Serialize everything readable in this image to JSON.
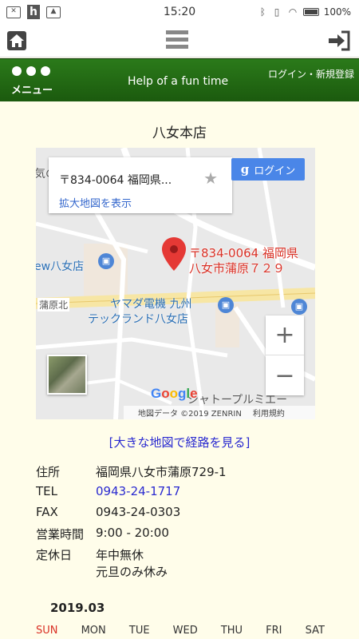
{
  "status_bar": {
    "time": "15:20",
    "battery": "100%"
  },
  "header": {
    "menu_label": "メニュー",
    "site_title": "Help of a fun time",
    "auth_link": "ログイン・新規登録"
  },
  "store": {
    "name": "八女本店"
  },
  "map": {
    "card_address": "〒834-0064 福岡県...",
    "enlarge_link": "拡大地図を表示",
    "google_login": "ログイン",
    "pin_label_line1": "〒834-0064 福岡県",
    "pin_label_line2": "八女市蒲原７２９",
    "places": {
      "shop_left": "ew八女店",
      "kamohara_kita": "蒲原北",
      "yamada_line1": "ヤマダ電機 九州",
      "yamada_line2": "テックランド八女店",
      "shatto": "シャトープルミエー",
      "top_left": "気の"
    },
    "google_logo": "Google",
    "attribution_data": "地図データ ©2019 ZENRIN",
    "attribution_terms": "利用規約"
  },
  "route_link": "[大きな地図で経路を見る]",
  "info": [
    {
      "label": "住所",
      "value": "福岡県八女市蒲原729-1"
    },
    {
      "label": "TEL",
      "value": "0943-24-1717"
    },
    {
      "label": "FAX",
      "value": "0943-24-0303"
    },
    {
      "label": "営業時間",
      "value": "9:00 - 20:00"
    },
    {
      "label": "定休日",
      "value": "年中無休",
      "value2": "元旦のみ休み"
    }
  ],
  "calendar": {
    "month": "2019.03",
    "weekdays": [
      "SUN",
      "MON",
      "TUE",
      "WED",
      "THU",
      "FRI",
      "SAT"
    ]
  }
}
